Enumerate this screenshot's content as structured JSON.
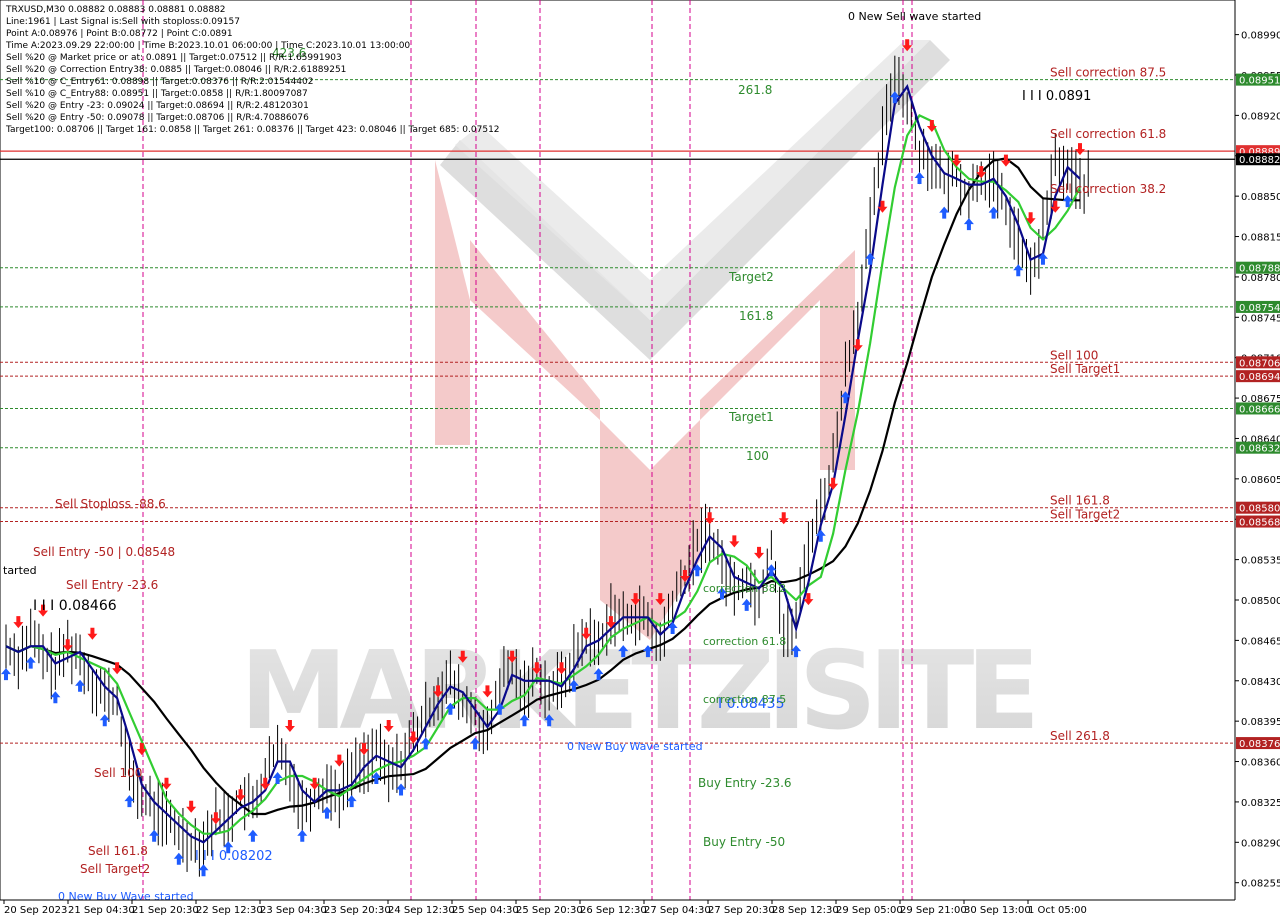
{
  "symbol_line": "TRXUSD,M30  0.08882 0.08883 0.08881 0.08882",
  "info_lines": [
    "Line:1961 | Last Signal is:Sell with stoploss:0.09157",
    "Point A:0.08976 | Point B:0.08772 | Point C:0.0891",
    "Time A:2023.09.29 22:00:00 | Time B:2023.10.01 06:00:00 | Time C:2023.10.01 13:00:00",
    "Sell %20 @ Market price or at: 0.0891 || Target:0.07512 || R/R:1.65991903",
    "Sell %20 @ Correction Entry38: 0.0885 || Target:0.08046 || R/R:2.61889251",
    "Sell %10 @ C_Entry61: 0.08898 || Target:0.08376 || R/R:2.01544402",
    "Sell %10 @ C_Entry88: 0.08951 || Target:0.0858 || R/R:1.80097087",
    "Sell %20 @ Entry -23: 0.09024 || Target:0.08694 || R/R:2.48120301",
    "Sell %20 @ Entry -50: 0.09078 || Target:0.08706 || R/R:4.70886076",
    "Target100: 0.08706 || Target 161: 0.0858 || Target 261: 0.08376 || Target 423: 0.08046 || Target 685: 0.07512"
  ],
  "watermark": "MARKETZISITE",
  "colors": {
    "buy_arrow": "#1e5cff",
    "sell_arrow": "#ff1a1a",
    "ma_fast": "#0a0a8a",
    "ma_mid": "#32cd32",
    "ma_slow": "#000000",
    "level_green": "#2e8b2e",
    "level_red": "#b22222",
    "session_line": "#d4008c",
    "current_price": "#e03030"
  },
  "right_tags": [
    {
      "price": 0.08951,
      "label": "0.08951",
      "color": "#2e8b2e"
    },
    {
      "price": 0.08889,
      "label": "0.08889",
      "color": "#e03030"
    },
    {
      "price": 0.08882,
      "label": "0.08882",
      "color": "#000000"
    },
    {
      "price": 0.08788,
      "label": "0.08788",
      "color": "#2e8b2e"
    },
    {
      "price": 0.08754,
      "label": "0.08754",
      "color": "#2e8b2e"
    },
    {
      "price": 0.08706,
      "label": "0.08706",
      "color": "#b22222"
    },
    {
      "price": 0.08694,
      "label": "0.08694",
      "color": "#b22222"
    },
    {
      "price": 0.08666,
      "label": "0.08666",
      "color": "#2e8b2e"
    },
    {
      "price": 0.08632,
      "label": "0.08632",
      "color": "#2e8b2e"
    },
    {
      "price": 0.0858,
      "label": "0.08580",
      "color": "#b22222"
    },
    {
      "price": 0.08568,
      "label": "0.08568",
      "color": "#b22222"
    },
    {
      "price": 0.08376,
      "label": "0.08376",
      "color": "#b22222"
    }
  ],
  "chart_data": {
    "type": "candlestick",
    "symbol": "TRXUSD",
    "timeframe": "M30",
    "ylim": [
      0.0824,
      0.0902
    ],
    "y_ticks": [
      "0.08990",
      "0.08955",
      "0.08920",
      "0.08885",
      "0.08850",
      "0.08815",
      "0.08780",
      "0.08745",
      "0.08710",
      "0.08675",
      "0.08640",
      "0.08605",
      "0.08570",
      "0.08535",
      "0.08500",
      "0.08465",
      "0.08430",
      "0.08395",
      "0.08360",
      "0.08325",
      "0.08290",
      "0.08255"
    ],
    "x_ticks": [
      "20 Sep 2023",
      "21 Sep 04:30",
      "21 Sep 20:30",
      "22 Sep 12:30",
      "23 Sep 04:30",
      "23 Sep 20:30",
      "24 Sep 12:30",
      "25 Sep 04:30",
      "25 Sep 20:30",
      "26 Sep 12:30",
      "27 Sep 04:30",
      "27 Sep 20:30",
      "28 Sep 12:30",
      "29 Sep 05:00",
      "29 Sep 21:00",
      "30 Sep 13:00",
      "1 Oct 05:00"
    ],
    "close_path": [
      0.0846,
      0.0845,
      0.0847,
      0.0845,
      0.0844,
      0.0846,
      0.0845,
      0.0843,
      0.0842,
      0.0841,
      0.0835,
      0.0833,
      0.0832,
      0.0831,
      0.083,
      0.0829,
      0.0829,
      0.0831,
      0.0831,
      0.0833,
      0.0832,
      0.0835,
      0.0837,
      0.0835,
      0.0832,
      0.0833,
      0.0834,
      0.0833,
      0.0835,
      0.0836,
      0.0837,
      0.0835,
      0.0836,
      0.0838,
      0.084,
      0.0842,
      0.0843,
      0.0841,
      0.084,
      0.0838,
      0.0843,
      0.0844,
      0.0842,
      0.0844,
      0.0842,
      0.0843,
      0.0845,
      0.0847,
      0.0846,
      0.0849,
      0.0848,
      0.0849,
      0.0848,
      0.0846,
      0.085,
      0.0852,
      0.0855,
      0.0856,
      0.0853,
      0.0851,
      0.0852,
      0.085,
      0.0855,
      0.0847,
      0.0848,
      0.0855,
      0.0858,
      0.0862,
      0.087,
      0.0875,
      0.0882,
      0.089,
      0.0896,
      0.0893,
      0.0889,
      0.0888,
      0.0886,
      0.0887,
      0.0885,
      0.0887,
      0.0886,
      0.0884,
      0.0881,
      0.0878,
      0.0882,
      0.0888,
      0.0887,
      0.0886
    ],
    "levels": [
      {
        "label": "Sell Entry -23.6",
        "price": 0.09024
      },
      {
        "label": "Sell correction 87.5",
        "price": 0.08951
      },
      {
        "label": "Sell correction 61.8",
        "price": 0.08898
      },
      {
        "label": "Sell correction 38.2",
        "price": 0.0885
      },
      {
        "label": "Sell 100",
        "price": 0.08706
      },
      {
        "label": "Sell Target1",
        "price": 0.08694
      },
      {
        "label": "Sell 161.8",
        "price": 0.0858
      },
      {
        "label": "Sell Target2",
        "price": 0.08568
      },
      {
        "label": "Sell 261.8",
        "price": 0.08376
      }
    ],
    "annotations": [
      "0 New Sell wave started",
      "I I I 0.0891",
      "I I I 0.08466",
      "I I I 0.08202",
      "I 0.08435",
      "0 New Buy Wave started",
      "Buy Entry -23.6",
      "Buy Entry -50",
      "Sell Stoploss -88.6",
      "Sell Entry -50 | 0.08548",
      "Sell Entry -23.6",
      "Sell 100",
      "Sell 161.8",
      "Sell Target2",
      "Target1",
      "Target2",
      "100",
      "161.8",
      "261.8",
      "423.6",
      "correction 38.2",
      "correction 61.8",
      "correction 87.5",
      "0 New Buy Wave started",
      "tarted"
    ],
    "legend": "none",
    "grid": false
  }
}
